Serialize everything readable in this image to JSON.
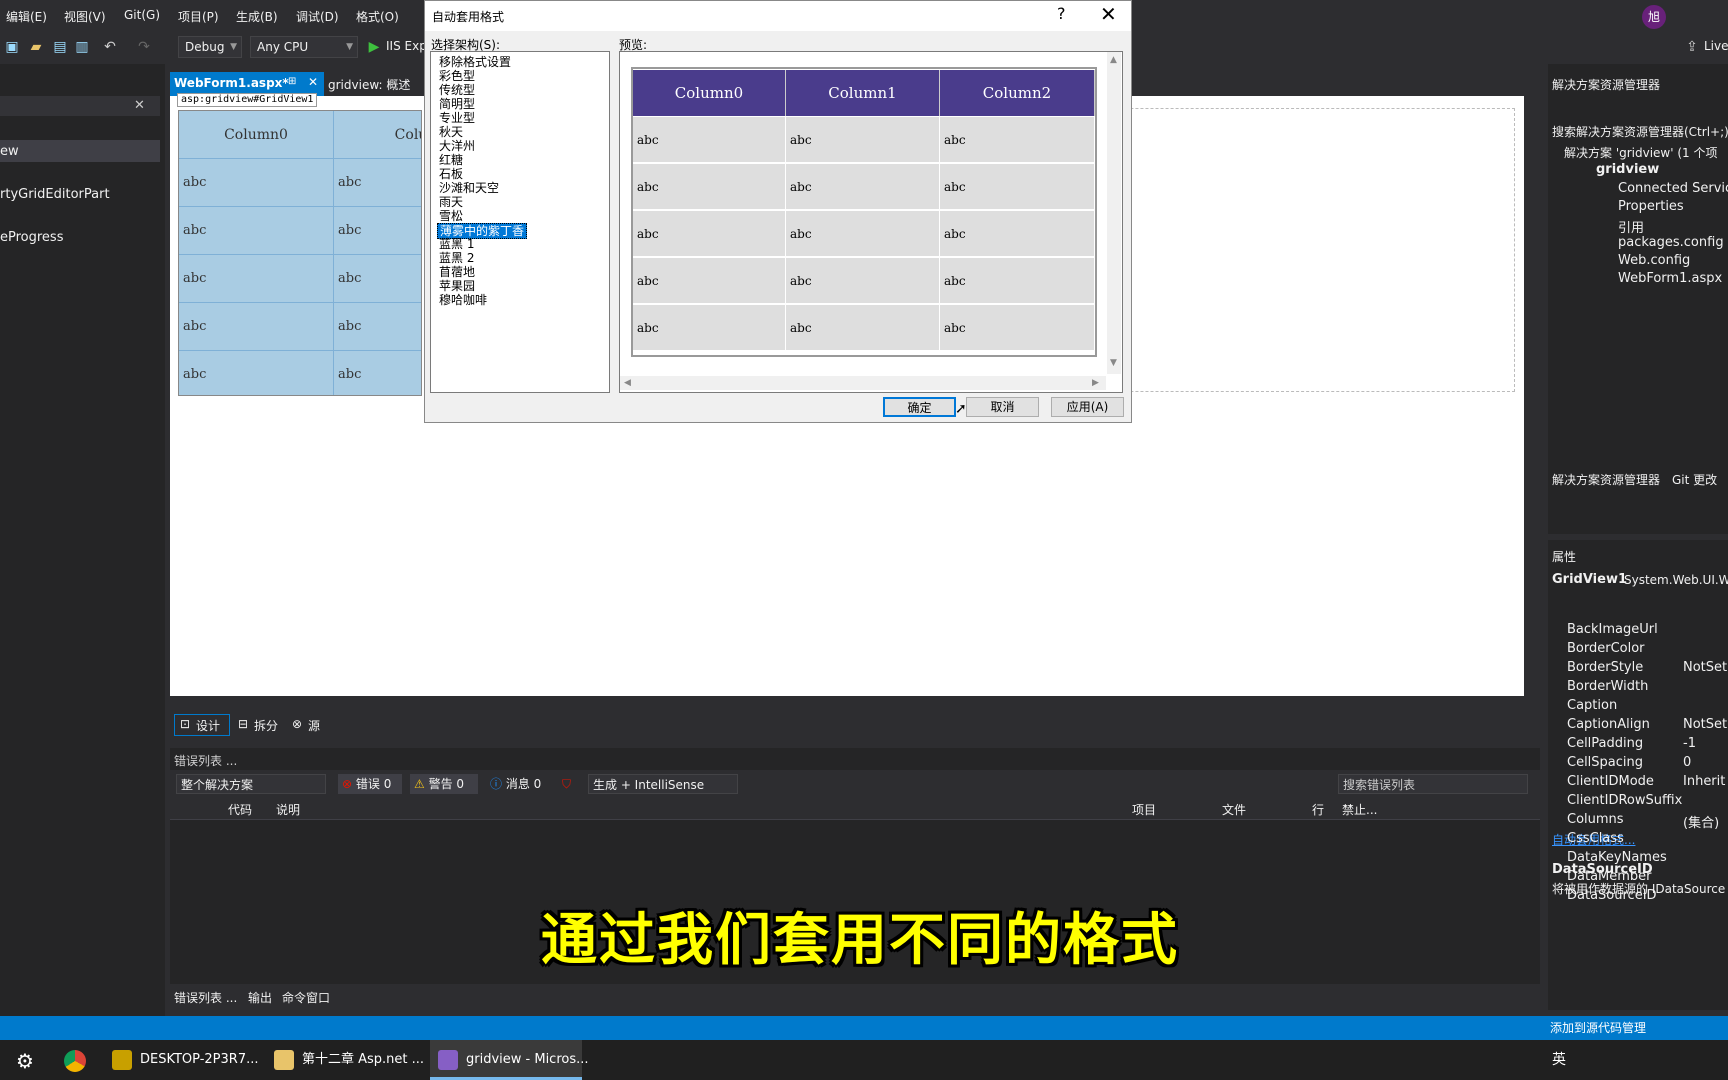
{
  "menu": {
    "items": [
      "编辑(E)",
      "视图(V)",
      "Git(G)",
      "项目(P)",
      "生成(B)",
      "调试(D)",
      "格式(O)"
    ],
    "avatar": "旭"
  },
  "toolbar": {
    "config": "Debug",
    "platform": "Any CPU",
    "run_label": "IIS Exp",
    "live_label": "Live"
  },
  "left_panel": {
    "items": [
      "ew",
      "rtyGridEditorPart",
      "eProgress"
    ]
  },
  "tabs": {
    "active": "WebForm1.aspx*",
    "second": "gridview: 概述"
  },
  "designer": {
    "tag": "asp:gridview#GridView1",
    "headers": [
      "Column0",
      "Colu"
    ],
    "cell": "abc"
  },
  "view_switcher": {
    "design": "设计",
    "split": "拆分",
    "source": "源"
  },
  "error_list": {
    "title": "错误列表 ...",
    "scope": "整个解决方案",
    "errors": "错误 0",
    "warnings": "警告 0",
    "messages": "消息 0",
    "build_filter": "生成 + IntelliSense",
    "search": "搜索错误列表",
    "columns": {
      "code": "代码",
      "desc": "说明",
      "project": "项目",
      "file": "文件",
      "line": "行",
      "suppress": "禁止..."
    }
  },
  "bottom_tabs": [
    "错误列表 ...",
    "输出",
    "命令窗口"
  ],
  "subtitle": "通过我们套用不同的格式",
  "solution_explorer": {
    "title": "解决方案资源管理器",
    "search": "搜索解决方案资源管理器(Ctrl+;)",
    "solution": "解决方案 'gridview' (1 个项",
    "project": "gridview",
    "items": [
      "Connected Services",
      "Properties",
      "引用",
      "packages.config",
      "Web.config",
      "WebForm1.aspx"
    ],
    "footer_tabs": [
      "解决方案资源管理器",
      "Git 更改"
    ]
  },
  "properties": {
    "title": "属性",
    "object": "GridView1",
    "object_type": "System.Web.UI.We",
    "rows": [
      {
        "name": "BackImageUrl",
        "value": ""
      },
      {
        "name": "BorderColor",
        "value": ""
      },
      {
        "name": "BorderStyle",
        "value": "NotSet"
      },
      {
        "name": "BorderWidth",
        "value": ""
      },
      {
        "name": "Caption",
        "value": ""
      },
      {
        "name": "CaptionAlign",
        "value": "NotSet"
      },
      {
        "name": "CellPadding",
        "value": "-1"
      },
      {
        "name": "CellSpacing",
        "value": "0"
      },
      {
        "name": "ClientIDMode",
        "value": "Inherit"
      },
      {
        "name": "ClientIDRowSuffix",
        "value": ""
      },
      {
        "name": "Columns",
        "value": "(集合)"
      },
      {
        "name": "CssClass",
        "value": ""
      },
      {
        "name": "DataKeyNames",
        "value": ""
      },
      {
        "name": "DataMember",
        "value": ""
      },
      {
        "name": "DataSourceID",
        "value": ""
      }
    ],
    "autoformat_link": "自动套用格式...",
    "desc_title": "DataSourceID",
    "desc_text": "将被用作数据源的 IDataSource"
  },
  "status": {
    "right": "添加到源代码管理"
  },
  "taskbar": {
    "items": [
      "DESKTOP-2P3R7...",
      "第十二章 Asp.net ...",
      "gridview - Micros..."
    ],
    "ime": "英"
  },
  "dialog": {
    "title": "自动套用格式",
    "help": "?",
    "scheme_label": "选择架构(S):",
    "preview_label": "预览:",
    "schemes": [
      "移除格式设置",
      "彩色型",
      "传统型",
      "简明型",
      "专业型",
      "秋天",
      "大洋州",
      "红糖",
      "石板",
      "沙滩和天空",
      "雨天",
      "雪松",
      "薄雾中的紫丁香",
      "蓝黑 1",
      "蓝黑 2",
      "苜蓿地",
      "苹果园",
      "穆哈咖啡"
    ],
    "selected_index": 12,
    "preview": {
      "headers": [
        "Column0",
        "Column1",
        "Column2"
      ],
      "cell": "abc",
      "header_color": "#4a3c8c",
      "row_color": "#dedede"
    },
    "ok": "确定",
    "cancel": "取消",
    "apply": "应用(A)"
  }
}
